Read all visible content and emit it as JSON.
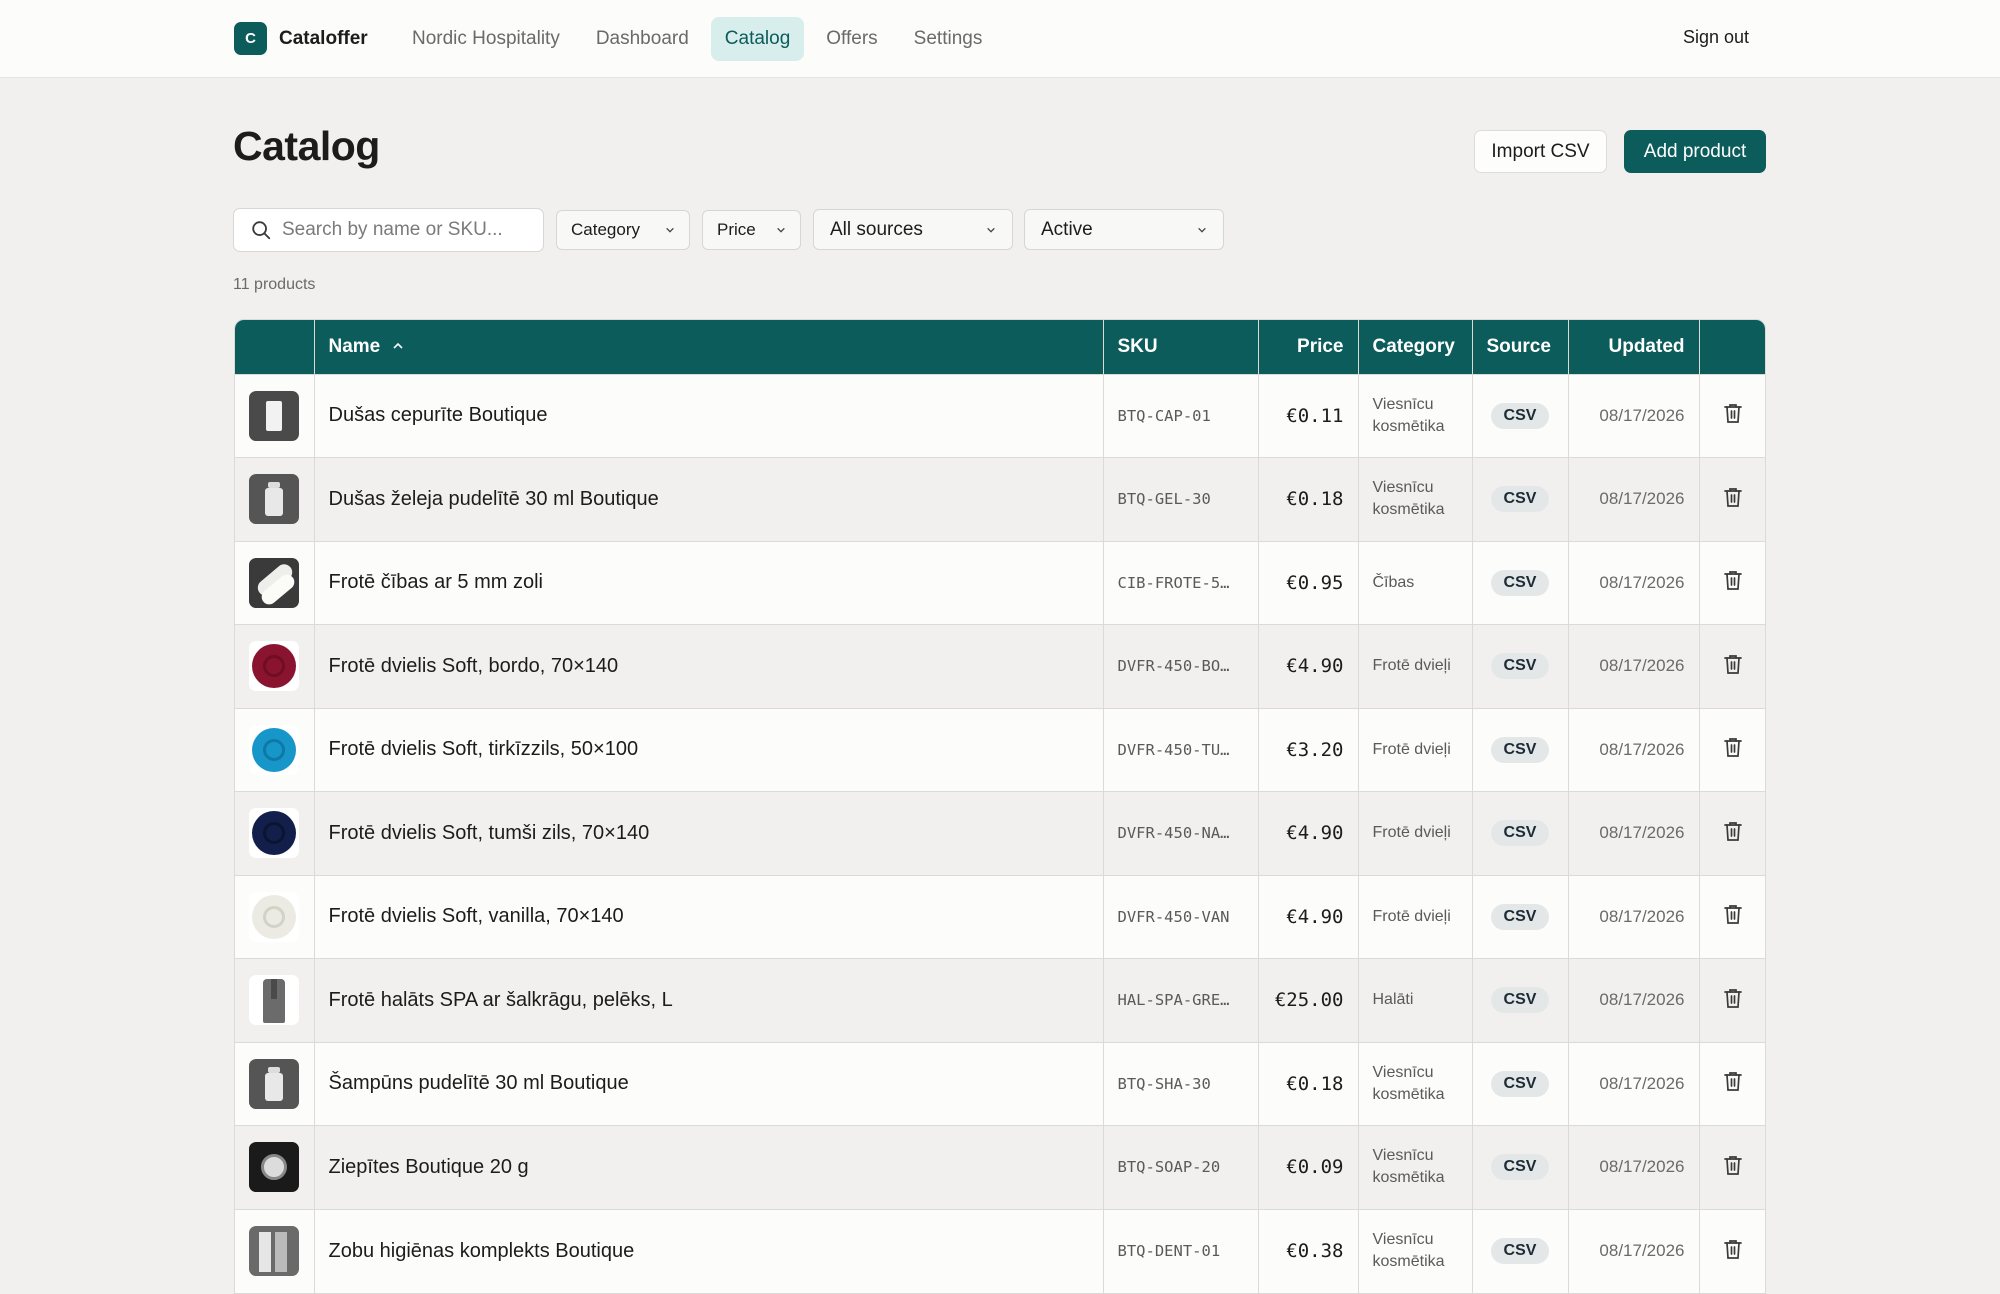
{
  "app": {
    "logo_letter": "C",
    "name": "Cataloffer",
    "nav": [
      "Nordic Hospitality",
      "Dashboard",
      "Catalog",
      "Offers",
      "Settings"
    ],
    "active_nav": "Catalog",
    "sign_out": "Sign out"
  },
  "header": {
    "title": "Catalog",
    "import_label": "Import CSV",
    "add_label": "Add product"
  },
  "filters": {
    "search_placeholder": "Search by name or SKU...",
    "category": "Category",
    "price": "Price",
    "source": "All sources",
    "status": "Active"
  },
  "count_label": "11 products",
  "table": {
    "columns": {
      "name": "Name",
      "sku": "SKU",
      "price": "Price",
      "category": "Category",
      "source": "Source",
      "updated": "Updated"
    },
    "rows": [
      {
        "thumb": "shower-cap",
        "name": "Dušas cepurīte Boutique",
        "sku": "BTQ-CAP-01",
        "price": "€0.11",
        "category": "Viesnīcu kosmētika",
        "source": "CSV",
        "updated": "08/17/2026"
      },
      {
        "thumb": "bottle",
        "name": "Dušas želeja pudelītē 30 ml Boutique",
        "sku": "BTQ-GEL-30",
        "price": "€0.18",
        "category": "Viesnīcu kosmētika",
        "source": "CSV",
        "updated": "08/17/2026"
      },
      {
        "thumb": "slippers",
        "name": "Frotē čības ar 5 mm zoli",
        "sku": "CIB-FROTE-5…",
        "price": "€0.95",
        "category": "Čības",
        "source": "CSV",
        "updated": "08/17/2026"
      },
      {
        "thumb": "towel-bordo",
        "name": "Frotē dvielis Soft, bordo, 70×140",
        "sku": "DVFR-450-BO…",
        "price": "€4.90",
        "category": "Frotē dvieļi",
        "source": "CSV",
        "updated": "08/17/2026"
      },
      {
        "thumb": "towel-turquoise",
        "name": "Frotē dvielis Soft, tirkīzzils, 50×100",
        "sku": "DVFR-450-TU…",
        "price": "€3.20",
        "category": "Frotē dvieļi",
        "source": "CSV",
        "updated": "08/17/2026"
      },
      {
        "thumb": "towel-navy",
        "name": "Frotē dvielis Soft, tumši zils, 70×140",
        "sku": "DVFR-450-NA…",
        "price": "€4.90",
        "category": "Frotē dvieļi",
        "source": "CSV",
        "updated": "08/17/2026"
      },
      {
        "thumb": "towel-vanilla",
        "name": "Frotē dvielis Soft, vanilla, 70×140",
        "sku": "DVFR-450-VAN",
        "price": "€4.90",
        "category": "Frotē dvieļi",
        "source": "CSV",
        "updated": "08/17/2026"
      },
      {
        "thumb": "bathrobe",
        "name": "Frotē halāts SPA ar šalkrāgu, pelēks, L",
        "sku": "HAL-SPA-GRE…",
        "price": "€25.00",
        "category": "Halāti",
        "source": "CSV",
        "updated": "08/17/2026"
      },
      {
        "thumb": "bottle",
        "name": "Šampūns pudelītē 30 ml Boutique",
        "sku": "BTQ-SHA-30",
        "price": "€0.18",
        "category": "Viesnīcu kosmētika",
        "source": "CSV",
        "updated": "08/17/2026"
      },
      {
        "thumb": "soap",
        "name": "Ziepītes Boutique 20 g",
        "sku": "BTQ-SOAP-20",
        "price": "€0.09",
        "category": "Viesnīcu kosmētika",
        "source": "CSV",
        "updated": "08/17/2026"
      },
      {
        "thumb": "dental-kit",
        "name": "Zobu higiēnas komplekts Boutique",
        "sku": "BTQ-DENT-01",
        "price": "€0.38",
        "category": "Viesnīcu kosmētika",
        "source": "CSV",
        "updated": "08/17/2026"
      }
    ]
  },
  "colors": {
    "brand": "#0b5c5b",
    "nav_active_bg": "#d7eeec",
    "badge_bg": "#e4e7e8"
  },
  "icons": {
    "search": "search-icon",
    "chevron": "chevron-down-icon",
    "sort": "sort-asc-icon",
    "delete": "trash-icon"
  }
}
